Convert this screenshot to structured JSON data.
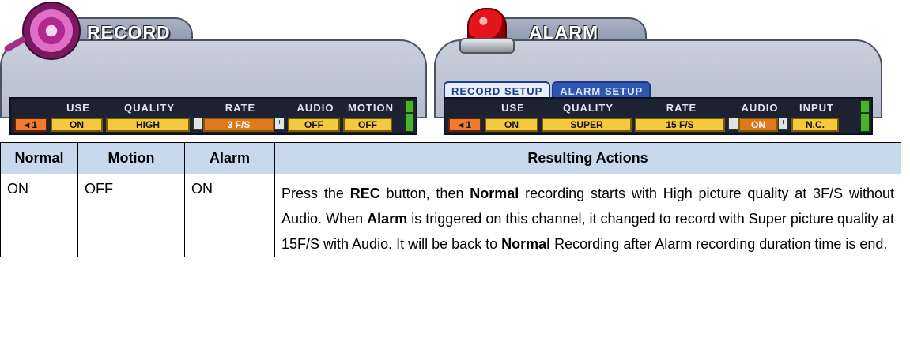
{
  "record_panel": {
    "title": "RECORD",
    "headers": [
      "USE",
      "QUALITY",
      "RATE",
      "AUDIO",
      "MOTION"
    ],
    "row": {
      "channel": "1",
      "use": "ON",
      "quality": "HIGH",
      "rate": "3 F/S",
      "audio": "OFF",
      "motion": "OFF"
    }
  },
  "alarm_panel": {
    "title": "ALARM",
    "tabs": [
      "RECORD SETUP",
      "ALARM SETUP"
    ],
    "headers": [
      "USE",
      "QUALITY",
      "RATE",
      "AUDIO",
      "INPUT"
    ],
    "row": {
      "channel": "1",
      "use": "ON",
      "quality": "SUPER",
      "rate": "15 F/S",
      "audio": "ON",
      "input": "N.C."
    }
  },
  "table": {
    "headers": [
      "Normal",
      "Motion",
      "Alarm",
      "Resulting Actions"
    ],
    "row": {
      "normal": "ON",
      "motion": "OFF",
      "alarm": "ON",
      "result_parts": [
        {
          "text": "Press the ",
          "bold": false
        },
        {
          "text": "REC",
          "bold": true
        },
        {
          "text": " button, then ",
          "bold": false
        },
        {
          "text": "Normal",
          "bold": true
        },
        {
          "text": " recording starts with High picture quality at 3F/S without Audio. When ",
          "bold": false
        },
        {
          "text": "Alarm",
          "bold": true
        },
        {
          "text": " is triggered on this channel, it changed to record with Super picture quality at 15F/S with Audio. It will be back to ",
          "bold": false
        },
        {
          "text": "Normal",
          "bold": true
        },
        {
          "text": " Recording after Alarm recording duration time is end.",
          "bold": false
        }
      ]
    }
  },
  "colors": {
    "header_bg": "#c8d9ee",
    "cell_yellow": "#f3c940",
    "cell_orange": "#f07a2d",
    "tab_blue": "#2e57b0"
  },
  "icons": {
    "record": "film-reel-icon",
    "alarm": "siren-light-icon"
  }
}
